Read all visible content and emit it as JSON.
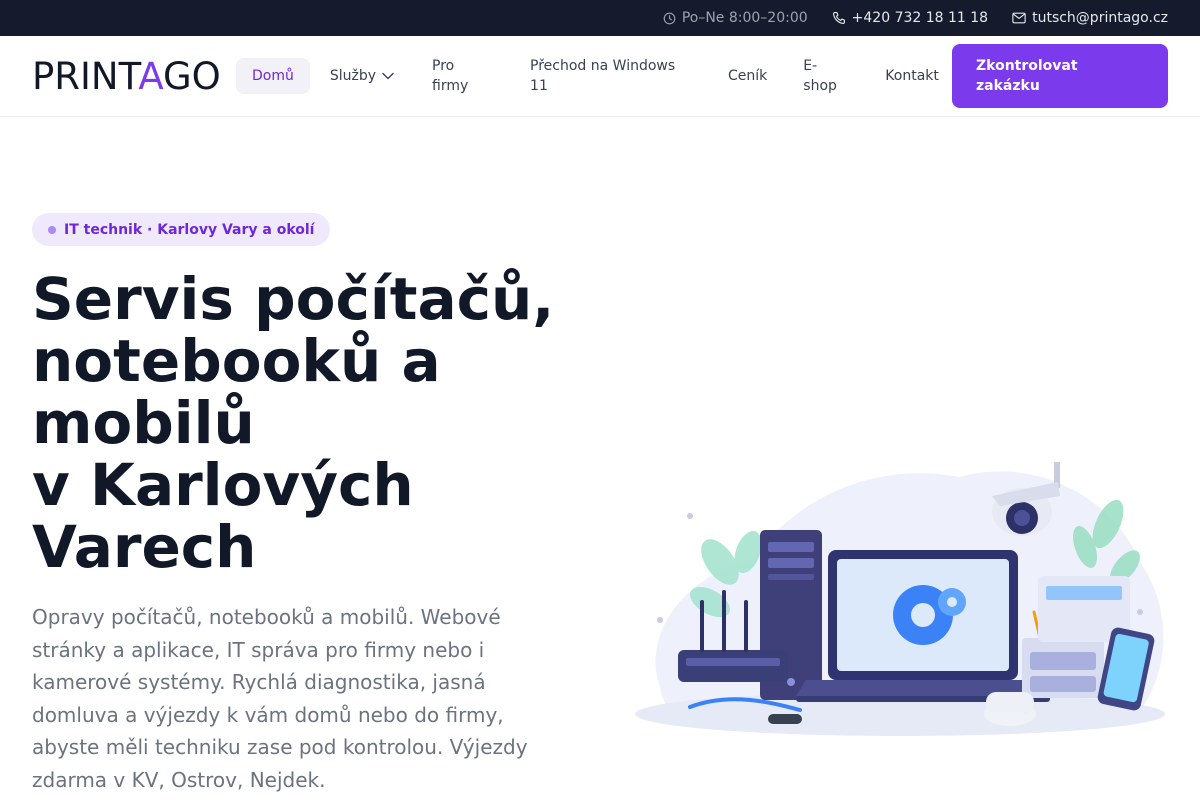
{
  "topbar": {
    "hours": "Po–Ne 8:00–20:00",
    "phone": "+420 732 18 11 18",
    "email": "tutsch@printago.cz"
  },
  "brand": {
    "logo_part1": "PRINT",
    "logo_accent": "A",
    "logo_part2": "GO",
    "accent_color": "#7c3aed"
  },
  "nav": {
    "home": "Domů",
    "services": "Služby",
    "business": "Pro firmy",
    "windows": "Přechod na Windows 11",
    "pricing": "Ceník",
    "eshop": "E-shop",
    "contact": "Kontakt"
  },
  "cta": {
    "label": "Zkontrolovat zakázku"
  },
  "hero": {
    "badge": "IT technik · Karlovy Vary a okolí",
    "title_line1": "Servis počítačů,",
    "title_line2": "notebooků a",
    "title_line3": "mobilů",
    "title_line4": "v Karlových",
    "title_line5": "Varech",
    "description": "Opravy počítačů, notebooků a mobilů. Webové stránky a aplikace, IT správa pro firmy nebo i kamerové systémy. Rychlá diagnostika, jasná domluva a výjezdy k vám domů nebo do firmy, abyste měli techniku zase pod kontrolou. Výjezdy zdarma v KV, Ostrov, Nejdek."
  },
  "icons": {
    "hours": "clock-icon",
    "phone": "phone-icon",
    "email": "mail-icon",
    "dropdown": "chevron-down-icon"
  }
}
